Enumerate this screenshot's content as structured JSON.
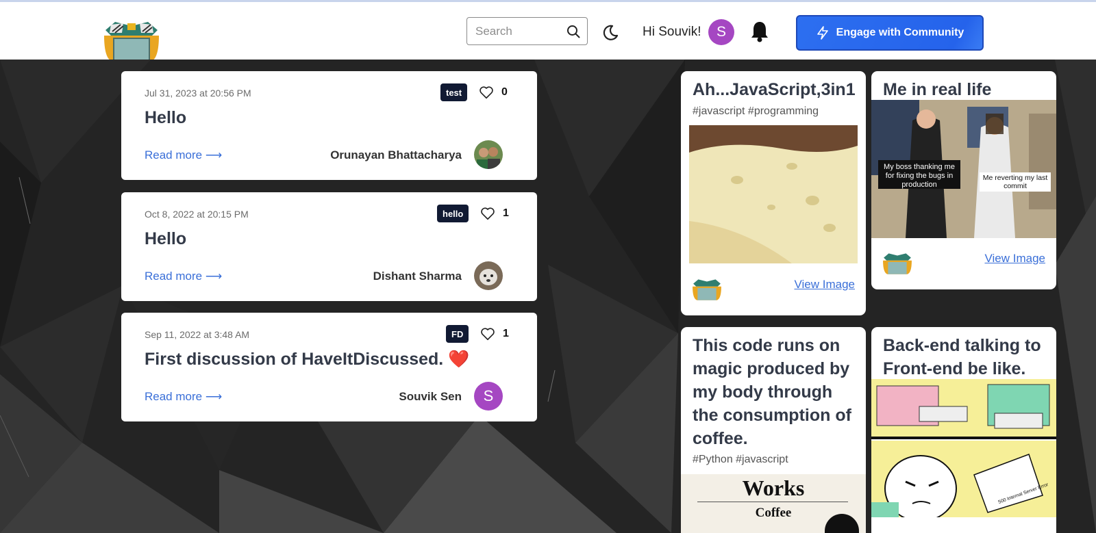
{
  "navbar": {
    "search_placeholder": "Search",
    "greeting": "Hi Souvik!",
    "avatar_letter": "S",
    "engage_label": "Engage with Community"
  },
  "posts": [
    {
      "date": "Jul 31, 2023 at 20:56 PM",
      "tag": "test",
      "likes": "0",
      "title": "Hello",
      "read_more": "Read more ⟶",
      "author": "Orunayan Bhattacharya"
    },
    {
      "date": "Oct 8, 2022 at 20:15 PM",
      "tag": "hello",
      "likes": "1",
      "title": "Hello",
      "read_more": "Read more ⟶",
      "author": "Dishant Sharma"
    },
    {
      "date": "Sep 11, 2022 at 3:48 AM",
      "tag": "FD",
      "likes": "1",
      "title": "First discussion of HaveItDiscussed. ❤️",
      "read_more": "Read more ⟶",
      "author": "Souvik Sen",
      "avatar_letter": "S"
    }
  ],
  "cards": [
    {
      "title": "Ah...JavaScript,3in1",
      "tags": "#javascript #programming",
      "view_label": "View Image"
    },
    {
      "title": "Me in real life",
      "view_label": "View Image",
      "meme_left": "My boss thanking me for fixing the bugs in production",
      "meme_right": "Me reverting my last commit"
    },
    {
      "title": "This code runs on magic produced by my body through the consumption of coffee.",
      "tags": "#Python #javascript",
      "meme_top": "Works",
      "meme_sub": "Coffee"
    },
    {
      "title": "Back-end talking to Front-end be like.",
      "meme_paper": "500 Internal Server Error"
    }
  ],
  "colors": {
    "accent": "#2563eb",
    "avatar": "#a547c2",
    "tag_bg": "#111a33",
    "link": "#3a6fd8"
  }
}
